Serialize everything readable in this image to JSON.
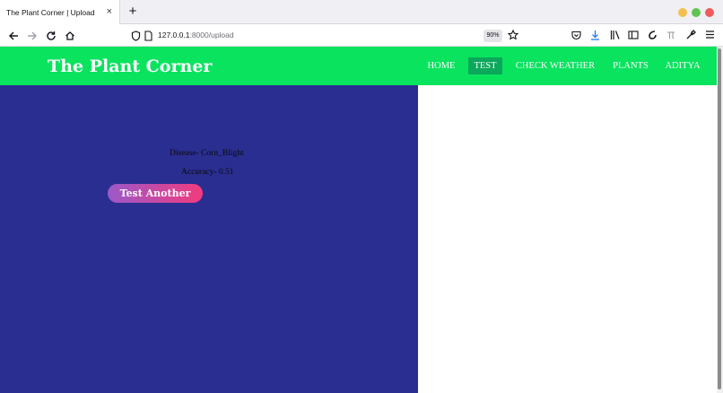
{
  "browser": {
    "tab_title": "The Plant Corner | Upload",
    "tab_close_glyph": "×",
    "new_tab_glyph": "+",
    "url_host": "127.0.0.1",
    "url_path": ":8000/upload",
    "zoom": "90%",
    "window_controls": {
      "minimize": "#f5bf4f",
      "maximize": "#60c453",
      "close": "#ee5c5c"
    }
  },
  "nav_icons": {
    "back": "arrow-left-icon",
    "forward": "arrow-right-icon",
    "reload": "reload-icon",
    "home": "home-icon"
  },
  "site": {
    "brand": "The Plant Corner",
    "menu": [
      {
        "label": "HOME",
        "active": false
      },
      {
        "label": "TEST",
        "active": true
      },
      {
        "label": "CHECK WEATHER",
        "active": false
      },
      {
        "label": "PLANTS",
        "active": false
      },
      {
        "label": "ADITYA",
        "active": false
      }
    ],
    "header_color": "#0ae35e",
    "active_color": "#0aa85a"
  },
  "result": {
    "disease": "Disease- Corn_Blight",
    "accuracy": "Accuracy- 0.51",
    "button": "Test Another",
    "panel_color": "#2a2e90"
  }
}
